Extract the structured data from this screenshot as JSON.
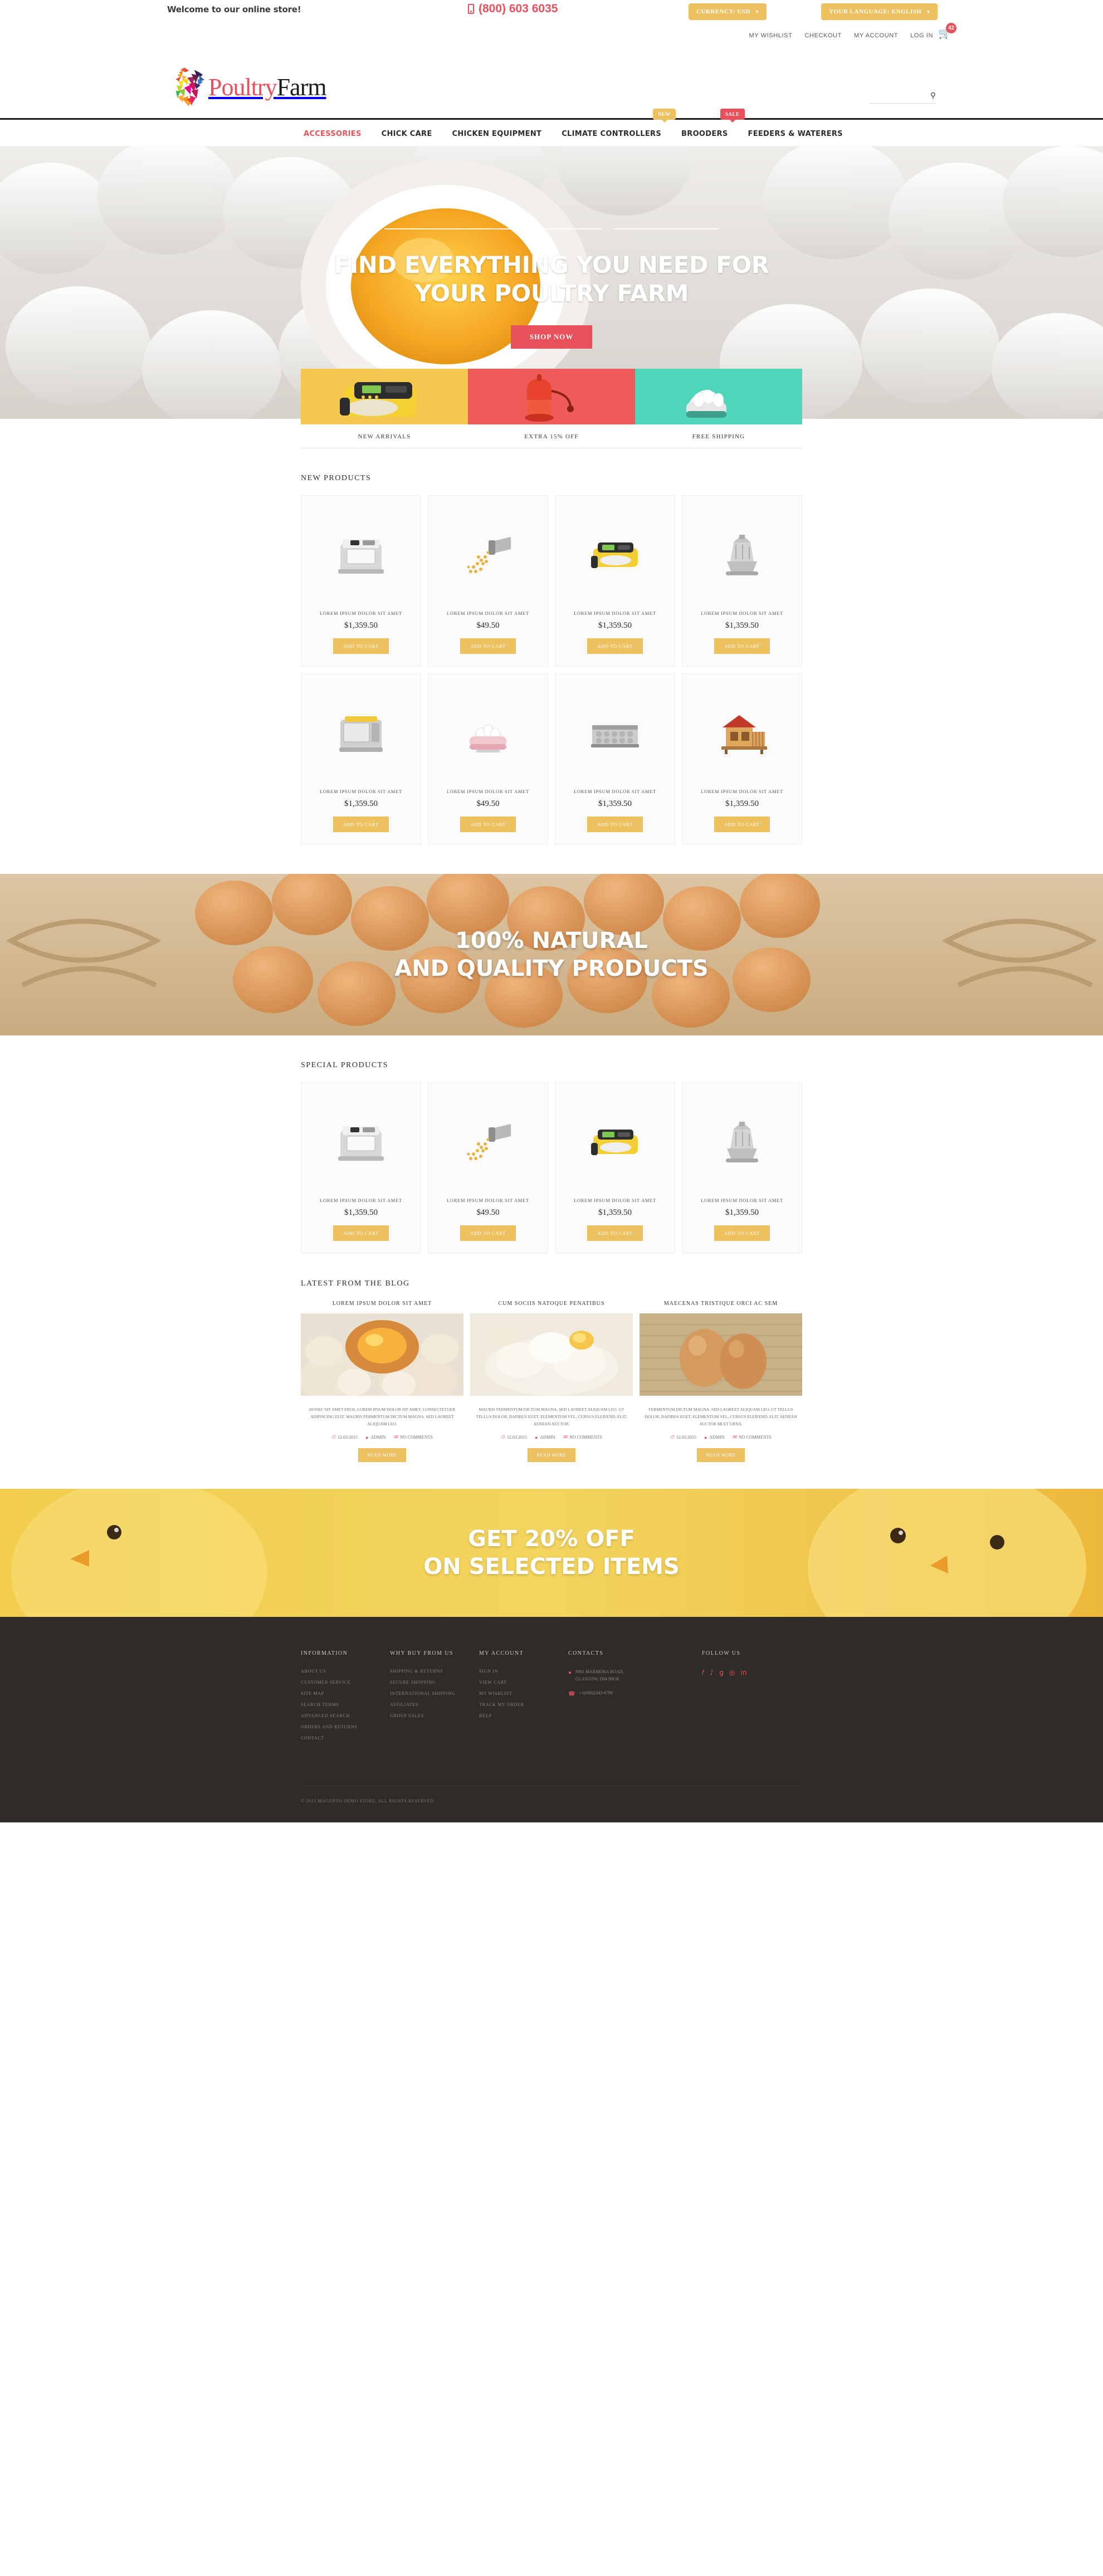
{
  "topbar": {
    "welcome": "Welcome to our online store!",
    "phone": "(800) 603 6035",
    "currency_label": "CURRENCY: USD",
    "language_label": "YOUR LANGUAGE: ENGLISH",
    "account_links": [
      "MY WISHLIST",
      "CHECKOUT",
      "MY ACCOUNT",
      "LOG IN"
    ],
    "cart_count": "42"
  },
  "logo": {
    "part1": "Poultry",
    "part2": "Farm"
  },
  "search": {
    "placeholder": "",
    "value": ""
  },
  "nav": {
    "items": [
      {
        "label": "ACCESSORIES",
        "active": true
      },
      {
        "label": "CHICK CARE",
        "active": false
      },
      {
        "label": "CHICKEN EQUIPMENT",
        "active": false
      },
      {
        "label": "CLIMATE CONTROLLERS",
        "active": false
      },
      {
        "label": "BROODERS",
        "active": false
      },
      {
        "label": "FEEDERS & WATERERS",
        "active": false
      }
    ],
    "badge_new": "NEW",
    "badge_sale": "SALE"
  },
  "hero": {
    "line1": "FIND EVERYTHING YOU NEED FOR",
    "line2": "YOUR POULTRY FARM",
    "cta": "SHOP NOW"
  },
  "tiles": [
    {
      "caption": "NEW ARRIVALS",
      "color": "#f4c84f"
    },
    {
      "caption": "EXTRA 15% OFF",
      "color": "#ef5a5a"
    },
    {
      "caption": "FREE SHIPPING",
      "color": "#4ed6ba"
    }
  ],
  "new_products": {
    "title": "NEW PRODUCTS",
    "items": [
      {
        "name": "LOREM IPSUM DOLOR SIT AMET",
        "price": "$1,359.50",
        "cta": "ADD TO CART",
        "img": "incubator-grey"
      },
      {
        "name": "LOREM IPSUM DOLOR SIT AMET",
        "price": "$49.50",
        "cta": "ADD TO CART",
        "img": "feed-scoop"
      },
      {
        "name": "LOREM IPSUM DOLOR SIT AMET",
        "price": "$1,359.50",
        "cta": "ADD TO CART",
        "img": "incubator-yellow"
      },
      {
        "name": "LOREM IPSUM DOLOR SIT AMET",
        "price": "$1,359.50",
        "cta": "ADD TO CART",
        "img": "feeder-metal"
      },
      {
        "name": "LOREM IPSUM DOLOR SIT AMET",
        "price": "$1,359.50",
        "cta": "ADD TO CART",
        "img": "incubator-steel"
      },
      {
        "name": "LOREM IPSUM DOLOR SIT AMET",
        "price": "$49.50",
        "cta": "ADD TO CART",
        "img": "egg-cooker"
      },
      {
        "name": "LOREM IPSUM DOLOR SIT AMET",
        "price": "$1,359.50",
        "cta": "ADD TO CART",
        "img": "egg-tray"
      },
      {
        "name": "LOREM IPSUM DOLOR SIT AMET",
        "price": "$1,359.50",
        "cta": "ADD TO CART",
        "img": "chicken-coop"
      }
    ]
  },
  "parallax": {
    "line1": "100% NATURAL",
    "line2": "AND QUALITY PRODUCTS"
  },
  "special_products": {
    "title": "SPECIAL PRODUCTS",
    "items": [
      {
        "name": "LOREM IPSUM DOLOR SIT AMET",
        "price": "$1,359.50",
        "cta": "ADD TO CART",
        "img": "incubator-grey"
      },
      {
        "name": "LOREM IPSUM DOLOR SIT AMET",
        "price": "$49.50",
        "cta": "ADD TO CART",
        "img": "feed-scoop"
      },
      {
        "name": "LOREM IPSUM DOLOR SIT AMET",
        "price": "$1,359.50",
        "cta": "ADD TO CART",
        "img": "incubator-yellow"
      },
      {
        "name": "LOREM IPSUM DOLOR SIT AMET",
        "price": "$1,359.50",
        "cta": "ADD TO CART",
        "img": "feeder-metal"
      }
    ]
  },
  "blog": {
    "title": "LATEST FROM THE BLOG",
    "posts": [
      {
        "title": "LOREM IPSUM DOLOR SIT AMET",
        "text": "DONEC SIT AMET EROS. LOREM IPSUM DOLOR SIT AMET, CONSECTETUER ADIPISCING ELIT. MAURIS FERMENTUM DICTUM MAGNA. SED LAOREET ALIQUAM LEO.",
        "date": "12.03.2015",
        "author": "ADMIN",
        "comments": "NO COMMENTS",
        "cta": "READ MORE",
        "img": "eggs-bowl"
      },
      {
        "title": "CUM SOCIIS NATOQUE PENATIBUS",
        "text": "MAURIS FERMENTUM DICTUM MAGNA. SED LAOREET ALIQUAM LEO. UT TELLUS DOLOR, DAPIBUS EGET, ELEMENTUM VEL, CURSUS ELEIFEND, ELIT. AENEAN AUCTOR.",
        "date": "12.03.2015",
        "author": "ADMIN",
        "comments": "NO COMMENTS",
        "cta": "READ MORE",
        "img": "flour-dough"
      },
      {
        "title": "MAECENAS TRISTIQUE ORCI AC SEM",
        "text": "FERMENTUM DICTUM MAGNA. SED LAOREET ALIQUAM LEO. UT TELLUS DOLOR, DAPIBUS EGET, ELEMENTUM VEL, CURSUS ELEIFEND, ELIT. AENEAN AUCTOR MI ET URNA.",
        "date": "12.03.2015",
        "author": "ADMIN",
        "comments": "NO COMMENTS",
        "cta": "READ MORE",
        "img": "two-eggs"
      }
    ]
  },
  "promo": {
    "line1": "GET 20% OFF",
    "line2": "ON SELECTED ITEMS"
  },
  "footer": {
    "columns": [
      {
        "head": "INFORMATION",
        "links": [
          "ABOUT US",
          "CUSTOMER SERVICE",
          "SITE MAP",
          "SEARCH TERMS",
          "ADVANCED SEARCH",
          "ORDERS AND RETURNS",
          "CONTACT"
        ]
      },
      {
        "head": "WHY BUY FROM US",
        "links": [
          "SHIPPING & RETURNS",
          "SECURE SHOPPING",
          "INTERNATIONAL SHIPPING",
          "AFFILIATES",
          "GROUP SALES"
        ]
      },
      {
        "head": "MY ACCOUNT",
        "links": [
          "SIGN IN",
          "VIEW CART",
          "MY WISHLIST",
          "TRACK MY ORDER",
          "HELP"
        ]
      }
    ],
    "contacts_head": "CONTACTS",
    "address": "8901 MARMORA ROAD,\nGLASGOW, D04 89GR",
    "phone": "+1(800)2343-6789",
    "follow_head": "FOLLOW US",
    "socials": [
      "facebook-icon",
      "twitter-icon",
      "google-plus-icon",
      "rss-icon",
      "linkedin-icon"
    ],
    "copyright": "© 2015 MAGENTO DEMO STORE. ALL RIGHTS RESERVED."
  }
}
